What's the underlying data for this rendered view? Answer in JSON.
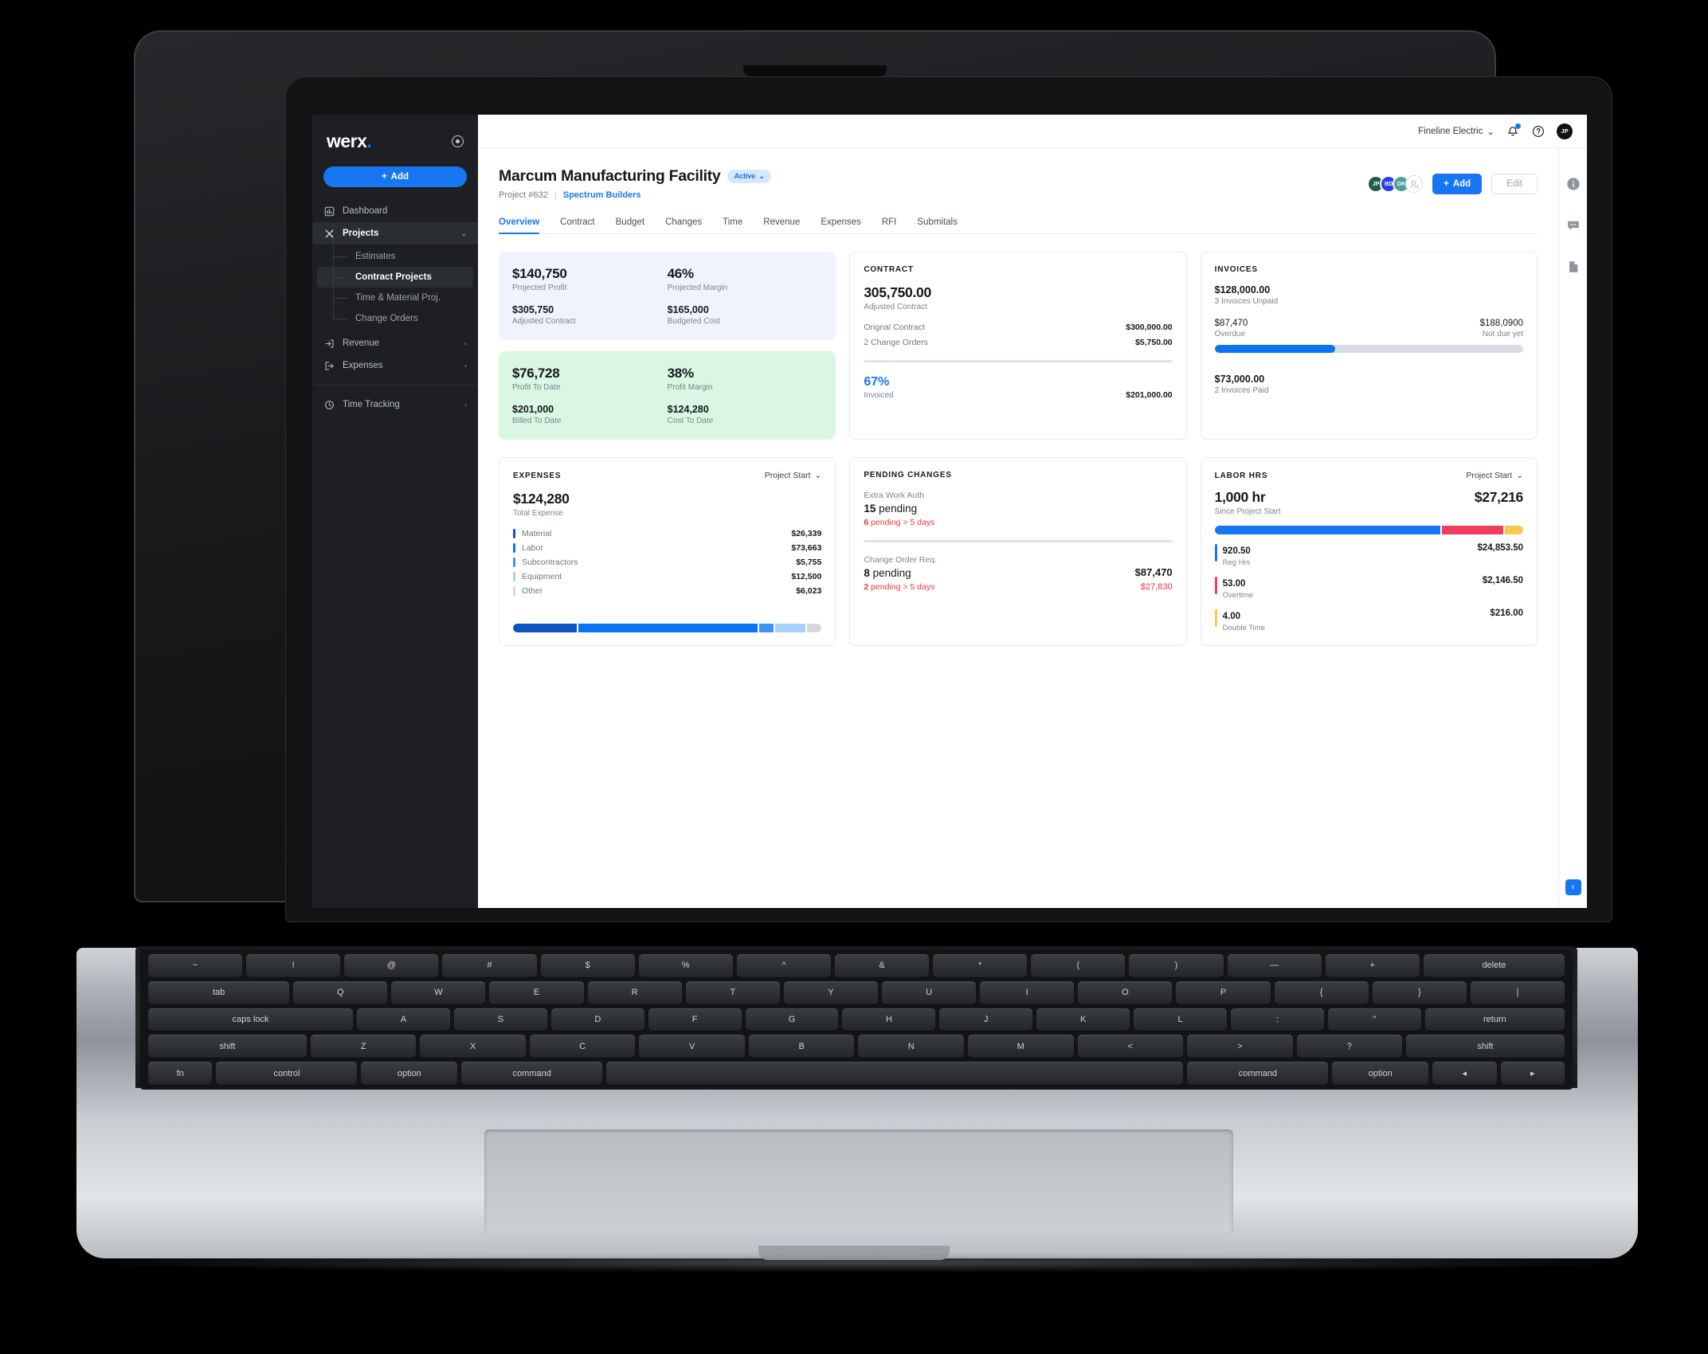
{
  "sidebar": {
    "brand": "werx",
    "brand_dot": ".",
    "add_label": "Add",
    "items": [
      {
        "label": "Dashboard",
        "icon": "chart-bar-icon"
      },
      {
        "label": "Projects",
        "icon": "tools-icon"
      },
      {
        "label": "Revenue",
        "icon": "arrow-into-box-icon"
      },
      {
        "label": "Expenses",
        "icon": "arrow-out-of-box-icon"
      },
      {
        "label": "Time Tracking",
        "icon": "clock-icon"
      }
    ],
    "sub_items": [
      {
        "label": "Estimates"
      },
      {
        "label": "Contract Projects"
      },
      {
        "label": "Time & Material Proj."
      },
      {
        "label": "Change Orders"
      }
    ]
  },
  "topbar": {
    "org": "Fineline Electric",
    "avatar_initials": "JP"
  },
  "header": {
    "title": "Marcum Manufacturing Facility",
    "status": "Active",
    "project_no": "Project #632",
    "client": "Spectrum Builders",
    "add_label": "Add",
    "edit_label": "Edit",
    "members": [
      {
        "initials": "JP",
        "color": "#1f5c50"
      },
      {
        "initials": "BD",
        "color": "#2f3fe0"
      },
      {
        "initials": "DK",
        "color": "#4f9e9b"
      }
    ]
  },
  "tabs": [
    {
      "label": "Overview"
    },
    {
      "label": "Contract"
    },
    {
      "label": "Budget"
    },
    {
      "label": "Changes"
    },
    {
      "label": "Time"
    },
    {
      "label": "Revenue"
    },
    {
      "label": "Expenses"
    },
    {
      "label": "RFI"
    },
    {
      "label": "Submitals"
    }
  ],
  "projected": {
    "profit_value": "$140,750",
    "profit_label": "Projected Profit",
    "margin_value": "46%",
    "margin_label": "Projected Margin",
    "contract_value": "$305,750",
    "contract_label": "Adjusted Contract",
    "cost_value": "$165,000",
    "cost_label": "Budgeted Cost"
  },
  "todate": {
    "profit_value": "$76,728",
    "profit_label": "Profit To Date",
    "margin_value": "38%",
    "margin_label": "Profit Margin",
    "billed_value": "$201,000",
    "billed_label": "Billed To Date",
    "cost_value": "$124,280",
    "cost_label": "Cost To Date"
  },
  "contract": {
    "title": "CONTRACT",
    "adjusted_value": "305,750.00",
    "adjusted_label": "Adjusted Contract",
    "original_label": "Orignal Contract",
    "original_value": "$300,000.00",
    "changes_label": "2 Change Orders",
    "changes_value": "$5,750.00",
    "invoiced_pct": "67%",
    "invoiced_label": "Invoiced",
    "invoiced_value": "$201,000.00"
  },
  "invoices": {
    "title": "INVOICES",
    "unpaid_value": "$128,000.00",
    "unpaid_label": "3 Invoices Unpaid",
    "overdue_value": "$87,470",
    "overdue_label": "Overdue",
    "notdue_value": "$188,0900",
    "notdue_label": "Not due yet",
    "paid_value": "$73,000.00",
    "paid_label": "2 Invoices Paid",
    "bar_fill_pct": 39
  },
  "expenses": {
    "title": "EXPENSES",
    "filter": "Project Start",
    "total_value": "$124,280",
    "total_label": "Total Expense",
    "items": [
      {
        "label": "Material",
        "value": "$26,339",
        "color": "#0c55bf",
        "pct": 21.2
      },
      {
        "label": "Labor",
        "value": "$73,663",
        "color": "#0b74f0",
        "pct": 59.3
      },
      {
        "label": "Subcontractors",
        "value": "$5,755",
        "color": "#3e92f6",
        "pct": 4.6
      },
      {
        "label": "Equipment",
        "value": "$12,500",
        "color": "#a9cffb",
        "pct": 10.1
      },
      {
        "label": "Other",
        "value": "$6,023",
        "color": "#d5d9de",
        "pct": 4.8
      }
    ]
  },
  "pending_changes": {
    "title": "PENDING CHANGES",
    "blocks": [
      {
        "label": "Extra Work Auth",
        "count": "15",
        "count_suffix": "pending",
        "warn_count": "6",
        "warn_text": "pending > 5 days",
        "amount": "",
        "warn_amount": ""
      },
      {
        "label": "Change Order Req.",
        "count": "8",
        "count_suffix": "pending",
        "warn_count": "2",
        "warn_text": "pending > 5 days",
        "amount": "$87,470",
        "warn_amount": "$27,830"
      }
    ]
  },
  "labor": {
    "title": "LABOR HRS",
    "filter": "Project Start",
    "hours_value": "1,000 hr",
    "hours_label": "Since Project Start",
    "total_amount": "$27,216",
    "items": [
      {
        "hours": "920.50",
        "label": "Reg Hrs",
        "amount": "$24,853.50",
        "color": "#1777f2",
        "pct": 74
      },
      {
        "hours": "53.00",
        "label": "Overtime",
        "amount": "$2,146.50",
        "color": "#ee3e5c",
        "pct": 20
      },
      {
        "hours": "4.00",
        "label": "Double Time",
        "amount": "$216.00",
        "color": "#f7ca4d",
        "pct": 6
      }
    ]
  },
  "rail": {
    "icons": [
      "info-icon",
      "comment-icon",
      "document-icon"
    ],
    "collapse": "‹"
  },
  "keyboard": {
    "row1": [
      "~",
      "!",
      "@",
      "#",
      "$",
      "%",
      "^",
      "&",
      "*",
      "(",
      ")",
      "—",
      "+",
      "delete"
    ],
    "row2": [
      "tab",
      "Q",
      "W",
      "E",
      "R",
      "T",
      "Y",
      "U",
      "I",
      "O",
      "P",
      "{",
      "}",
      "|"
    ],
    "row3": [
      "caps lock",
      "A",
      "S",
      "D",
      "F",
      "G",
      "H",
      "J",
      "K",
      "L",
      ":",
      "\"",
      "return"
    ],
    "row4": [
      "shift",
      "Z",
      "X",
      "C",
      "V",
      "B",
      "N",
      "M",
      "<",
      ">",
      "?",
      "shift"
    ],
    "row5": [
      "fn",
      "control",
      "option",
      "command",
      "",
      "command",
      "option",
      "◂",
      "▸"
    ]
  }
}
